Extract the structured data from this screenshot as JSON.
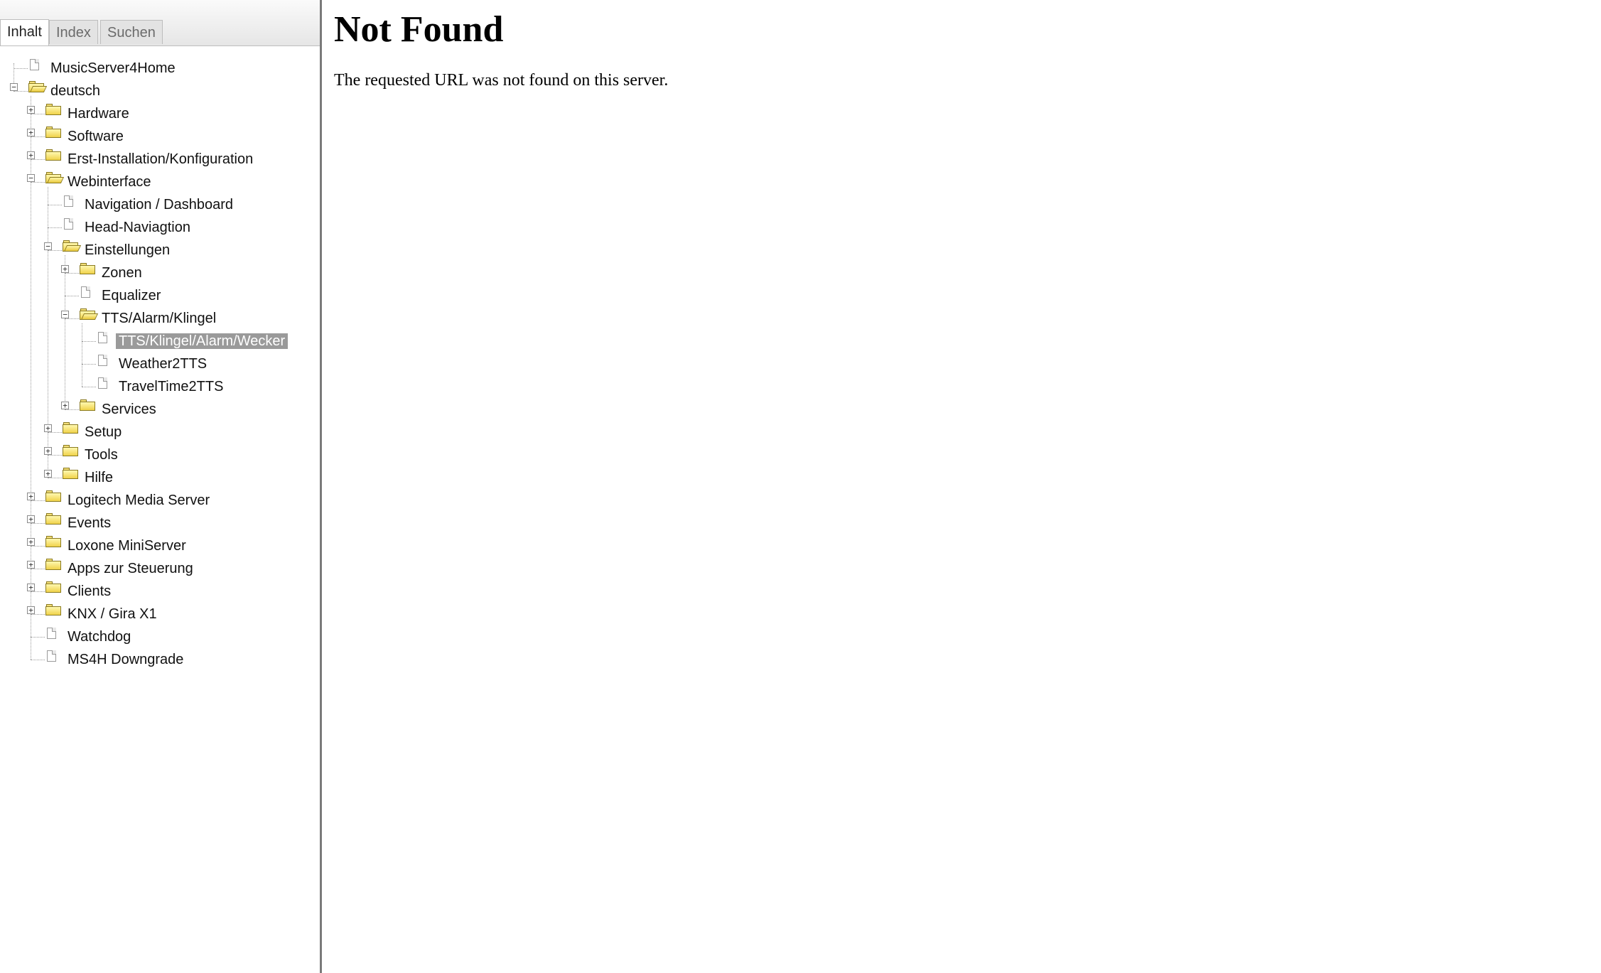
{
  "tabs": [
    "Inhalt",
    "Index",
    "Suchen"
  ],
  "tree": [
    {
      "label": "MusicServer4Home",
      "level": 0,
      "kind": "page"
    },
    {
      "label": "deutsch",
      "level": 0,
      "kind": "folder-open",
      "expander": "minus"
    },
    {
      "label": "Hardware",
      "level": 1,
      "kind": "folder",
      "expander": "plus"
    },
    {
      "label": "Software",
      "level": 1,
      "kind": "folder",
      "expander": "plus"
    },
    {
      "label": "Erst-Installation/Konfiguration",
      "level": 1,
      "kind": "folder",
      "expander": "plus"
    },
    {
      "label": "Webinterface",
      "level": 1,
      "kind": "folder-open",
      "expander": "minus"
    },
    {
      "label": "Navigation / Dashboard",
      "level": 2,
      "kind": "page"
    },
    {
      "label": "Head-Naviagtion",
      "level": 2,
      "kind": "page"
    },
    {
      "label": "Einstellungen",
      "level": 2,
      "kind": "folder-open",
      "expander": "minus"
    },
    {
      "label": "Zonen",
      "level": 3,
      "kind": "folder",
      "expander": "plus"
    },
    {
      "label": "Equalizer",
      "level": 3,
      "kind": "page"
    },
    {
      "label": "TTS/Alarm/Klingel",
      "level": 3,
      "kind": "folder-open",
      "expander": "minus"
    },
    {
      "label": "TTS/Klingel/Alarm/Wecker",
      "level": 4,
      "kind": "page",
      "selected": true
    },
    {
      "label": "Weather2TTS",
      "level": 4,
      "kind": "page"
    },
    {
      "label": "TravelTime2TTS",
      "level": 4,
      "kind": "page"
    },
    {
      "label": "Services",
      "level": 3,
      "kind": "folder",
      "expander": "plus"
    },
    {
      "label": "Setup",
      "level": 2,
      "kind": "folder",
      "expander": "plus"
    },
    {
      "label": "Tools",
      "level": 2,
      "kind": "folder",
      "expander": "plus"
    },
    {
      "label": "Hilfe",
      "level": 2,
      "kind": "folder",
      "expander": "plus"
    },
    {
      "label": "Logitech Media Server",
      "level": 1,
      "kind": "folder",
      "expander": "plus"
    },
    {
      "label": "Events",
      "level": 1,
      "kind": "folder",
      "expander": "plus"
    },
    {
      "label": "Loxone MiniServer",
      "level": 1,
      "kind": "folder",
      "expander": "plus"
    },
    {
      "label": "Apps zur Steuerung",
      "level": 1,
      "kind": "folder",
      "expander": "plus"
    },
    {
      "label": "Clients",
      "level": 1,
      "kind": "folder",
      "expander": "plus"
    },
    {
      "label": "KNX / Gira X1",
      "level": 1,
      "kind": "folder",
      "expander": "plus"
    },
    {
      "label": "Watchdog",
      "level": 1,
      "kind": "page"
    },
    {
      "label": "MS4H Downgrade",
      "level": 1,
      "kind": "page"
    }
  ],
  "main": {
    "title": "Not Found",
    "message": "The requested URL was not found on this server."
  }
}
